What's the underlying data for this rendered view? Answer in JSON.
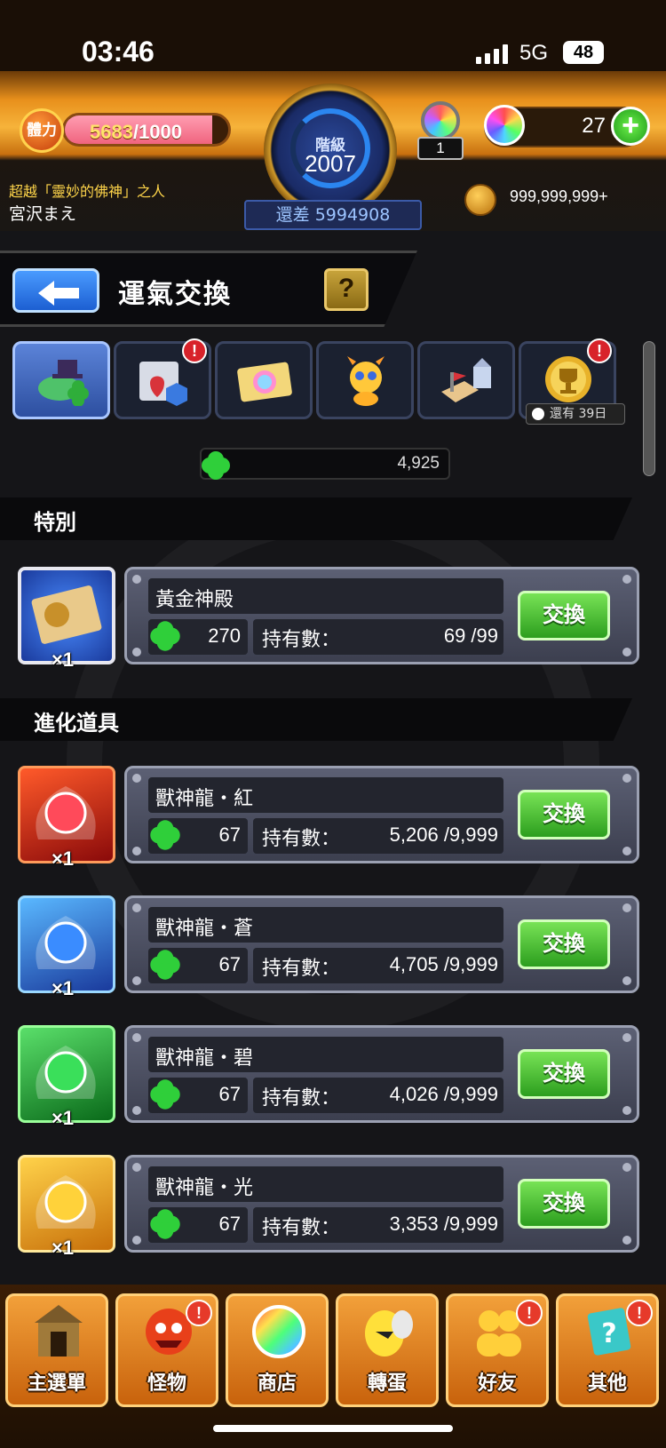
{
  "status_bar": {
    "time": "03:46",
    "network": "5G",
    "battery": "48"
  },
  "header": {
    "stamina_label": "體力",
    "stamina_current": "5683",
    "stamina_max": "/1000",
    "rank_label": "階級",
    "rank_value": "2007",
    "rank_remaining": "還差 5994908",
    "player_title": "超越「靈妙的佛神」之人",
    "player_name": "宮沢まえ",
    "gacha_ticket_count": "1",
    "orb_count": "27",
    "coin_count": "999,999,999+"
  },
  "page": {
    "title": "運氣交換",
    "help_label": "?",
    "tab_note": "還有 39日",
    "clover_total": "4,925"
  },
  "tabs": [
    {
      "icon": "clover-hat-icon",
      "badge": "",
      "active": true
    },
    {
      "icon": "item-bundle-icon",
      "badge": "!"
    },
    {
      "icon": "rainbow-card-icon",
      "badge": ""
    },
    {
      "icon": "dragon-mascot-icon",
      "badge": ""
    },
    {
      "icon": "castle-map-icon",
      "badge": ""
    },
    {
      "icon": "trophy-icon",
      "badge": "!"
    }
  ],
  "sections": {
    "special": "特別",
    "evolution": "進化道具"
  },
  "items": [
    {
      "name": "黃金神殿",
      "cost": "270",
      "own_label": "持有數：",
      "own": "69 /99",
      "qty": "×1",
      "button": "交換"
    },
    {
      "name": "獸神龍・紅",
      "cost": "67",
      "own_label": "持有數：",
      "own": "5,206 /9,999",
      "qty": "×1",
      "button": "交換"
    },
    {
      "name": "獸神龍・蒼",
      "cost": "67",
      "own_label": "持有數：",
      "own": "4,705 /9,999",
      "qty": "×1",
      "button": "交換"
    },
    {
      "name": "獸神龍・碧",
      "cost": "67",
      "own_label": "持有數：",
      "own": "4,026 /9,999",
      "qty": "×1",
      "button": "交換"
    },
    {
      "name": "獸神龍・光",
      "cost": "67",
      "own_label": "持有數：",
      "own": "3,353 /9,999",
      "qty": "×1",
      "button": "交換"
    }
  ],
  "bottom_nav": [
    {
      "label": "主選單",
      "badge": ""
    },
    {
      "label": "怪物",
      "badge": "!"
    },
    {
      "label": "商店",
      "badge": ""
    },
    {
      "label": "轉蛋",
      "badge": ""
    },
    {
      "label": "好友",
      "badge": "!"
    },
    {
      "label": "其他",
      "badge": "!"
    }
  ],
  "colors": {
    "exchange_button": "#2c9e1e",
    "active_tab": "#2d4fa0",
    "badge_red": "#d8222a",
    "stamina_fill": "#f0647f"
  },
  "stamina_fill_fraction": 0.9
}
